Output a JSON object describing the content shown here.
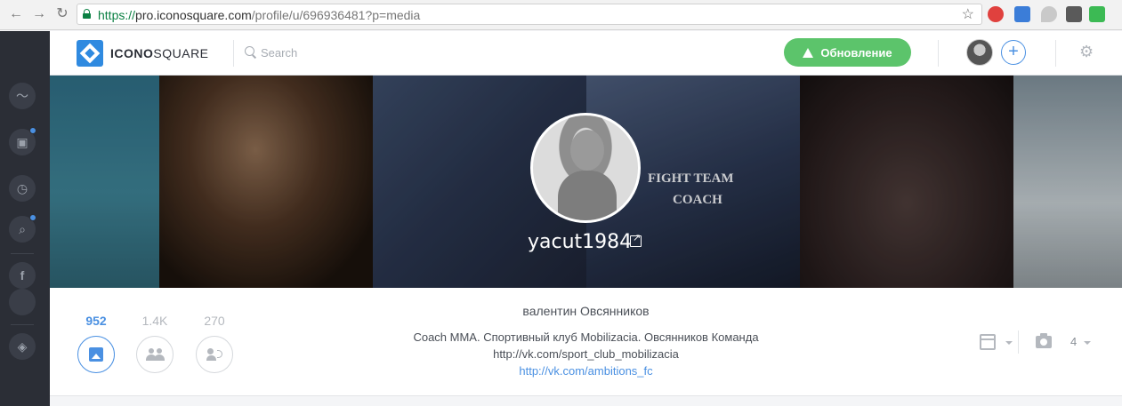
{
  "browser": {
    "url_scheme": "https://",
    "url_host": "pro.iconosquare.com",
    "url_path": "/profile/u/696936481?p=media"
  },
  "header": {
    "logo_bold": "ICONO",
    "logo_light": "SQUARE",
    "search_placeholder": "Search",
    "update_label": "Обновление"
  },
  "profile": {
    "username": "yacut1984",
    "full_name": "валентин Овсянников",
    "bio_line1": "Coach MMA. Спортивный клуб Mobilizacia. Овсянников Команда",
    "bio_line2": "http://vk.com/sport_club_mobilizacia",
    "bio_link": "http://vk.com/ambitions_fc"
  },
  "cover": {
    "shirt_text_1": "FIGHT TEAM",
    "shirt_text_2": "COACH"
  },
  "stats": [
    {
      "value": "952",
      "icon": "media-icon"
    },
    {
      "value": "1.4K",
      "icon": "followers-icon"
    },
    {
      "value": "270",
      "icon": "following-icon"
    }
  ],
  "filters": {
    "media_count": "4"
  },
  "colors": {
    "accent": "#4a90e2",
    "update_green": "#5cc46b",
    "sidebar": "#2b2e36"
  }
}
